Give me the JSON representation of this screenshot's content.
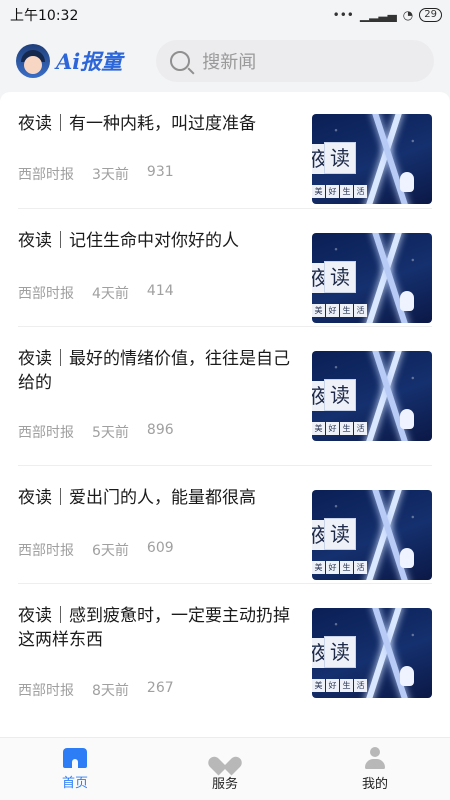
{
  "status_bar": {
    "time": "上午10:32",
    "battery": "29"
  },
  "header": {
    "logo_text": "Ai报童",
    "search_placeholder": "搜新闻"
  },
  "feed": {
    "items": [
      {
        "title": "夜读｜有一种内耗，叫过度准备",
        "source": "西部时报",
        "time": "3天前",
        "count": "931",
        "thumb_title": "读",
        "thumb_left": "夜",
        "thumb_sub": [
          "美",
          "好",
          "生",
          "活"
        ]
      },
      {
        "title": "夜读｜记住生命中对你好的人",
        "source": "西部时报",
        "time": "4天前",
        "count": "414",
        "thumb_title": "读",
        "thumb_left": "夜",
        "thumb_sub": [
          "美",
          "好",
          "生",
          "活"
        ]
      },
      {
        "title": "夜读｜最好的情绪价值，往往是自己给的",
        "source": "西部时报",
        "time": "5天前",
        "count": "896",
        "thumb_title": "读",
        "thumb_left": "夜",
        "thumb_sub": [
          "美",
          "好",
          "生",
          "活"
        ]
      },
      {
        "title": "夜读｜爱出门的人，能量都很高",
        "source": "西部时报",
        "time": "6天前",
        "count": "609",
        "thumb_title": "读",
        "thumb_left": "夜",
        "thumb_sub": [
          "美",
          "好",
          "生",
          "活"
        ]
      },
      {
        "title": "夜读｜感到疲惫时，一定要主动扔掉这两样东西",
        "source": "西部时报",
        "time": "8天前",
        "count": "267",
        "thumb_title": "读",
        "thumb_left": "夜",
        "thumb_sub": [
          "美",
          "好",
          "生",
          "活"
        ]
      }
    ]
  },
  "bottom_nav": {
    "items": [
      {
        "label": "首页",
        "icon": "home-icon",
        "active": true
      },
      {
        "label": "服务",
        "icon": "service-icon",
        "active": false
      },
      {
        "label": "我的",
        "icon": "me-icon",
        "active": false
      }
    ]
  },
  "colors": {
    "accent": "#2d7df6",
    "logo": "#2d66d8",
    "meta": "#a0a0a0"
  }
}
